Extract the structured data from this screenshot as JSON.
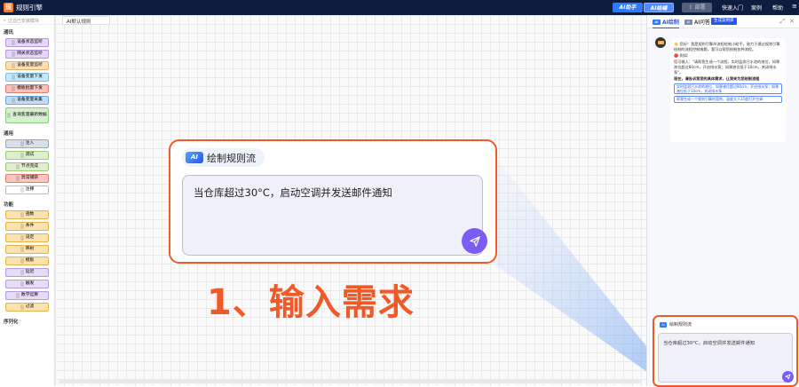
{
  "topbar": {
    "logo_text": "规",
    "app_title": "规则引擎",
    "ai_assistant": "AI助手",
    "ai_draw": "AI绘编",
    "deploy": "部署",
    "nav": [
      "快速入门",
      "案例",
      "帮助"
    ]
  },
  "sidebar": {
    "search_placeholder": "过滤已安装模块",
    "categories": [
      {
        "title": "通讯",
        "items": [
          {
            "label": "设备状态监听",
            "color": "#e6d6f7",
            "border": "#b896e0"
          },
          {
            "label": "网关状态监听",
            "color": "#e6d6f7",
            "border": "#b896e0"
          },
          {
            "label": "设备变量监听",
            "color": "#fde0b8",
            "border": "#e9b066"
          },
          {
            "label": "设备变量下发",
            "color": "#c7e6f7",
            "border": "#7cbfe3"
          },
          {
            "label": "模板批量下发",
            "color": "#f7c3bd",
            "border": "#e07d72"
          },
          {
            "label": "设备变量采集",
            "color": "#c4dcf5",
            "border": "#6ea5e0"
          },
          {
            "label": "查询变量最新数据",
            "color": "#d5efd0",
            "border": "#8ccc7f",
            "tall": true
          }
        ]
      },
      {
        "title": "通用",
        "items": [
          {
            "label": "注入",
            "color": "#d9dfe8",
            "border": "#9aa6b8"
          },
          {
            "label": "调试",
            "color": "#dfeed0",
            "border": "#9ccb73"
          },
          {
            "label": "节点完成",
            "color": "#dfeed0",
            "border": "#9ccb73"
          },
          {
            "label": "异常捕获",
            "color": "#f7c7c0",
            "border": "#e07d72"
          },
          {
            "label": "注释",
            "color": "#ffffff",
            "border": "#bbbbbb"
          }
        ]
      },
      {
        "title": "功能",
        "items": [
          {
            "label": "函数",
            "color": "#fbe3b0",
            "border": "#e5b24e"
          },
          {
            "label": "条件",
            "color": "#fbe3b0",
            "border": "#e5b24e"
          },
          {
            "label": "设定",
            "color": "#fbe3b0",
            "border": "#e5b24e"
          },
          {
            "label": "映射",
            "color": "#fbe3b0",
            "border": "#e5b24e"
          },
          {
            "label": "模板",
            "color": "#fbe3b0",
            "border": "#e5b24e"
          },
          {
            "label": "延迟",
            "color": "#e6dcf5",
            "border": "#b39be0"
          },
          {
            "label": "触发",
            "color": "#e6dcf5",
            "border": "#b39be0"
          },
          {
            "label": "数学运算",
            "color": "#e6dcf5",
            "border": "#b39be0"
          },
          {
            "label": "过滤",
            "color": "#fbe3b0",
            "border": "#e5b24e"
          }
        ]
      },
      {
        "title": "序列化",
        "items": []
      }
    ]
  },
  "canvas": {
    "tab_label": "AI默认规则"
  },
  "bigcard": {
    "badge": "AI",
    "title": "绘制规则流",
    "prompt": "当仓库超过30°C，启动空调并发送邮件通知"
  },
  "step_label": "1、输入需求",
  "rightpanel": {
    "tab_draw": "AI绘制",
    "tab_qa": "AI问答",
    "new_badge": "生成案例库",
    "intro": "👋 您好！我是规则引擎AI流程绘制小助手。致力于通过规则引擎绘制的流程控制难题，我可以帮您绘制各种流程。",
    "example_title": "🔴 例如:",
    "example_text": "您可输入：\"请帮我生成一个流程，实时监测污水池的液位，如果液位超过80cm，开启排水泵；如果液位低于10cm，关闭排水泵\"。",
    "prompt_hint": "现在，请告诉我您的具体需求，让我来为您绘制流程",
    "suggestions": [
      "实时监测污水池的液位，如果液位超过80cm，开启排水泵；如果液位低于10cm，关闭排水泵",
      "帮我生成一个规则引擎的案例，温度大于25度打开空调"
    ],
    "input_title": "绘制规则流",
    "input_text": "当仓库超过30°C，启动空调并发送邮件通知"
  }
}
